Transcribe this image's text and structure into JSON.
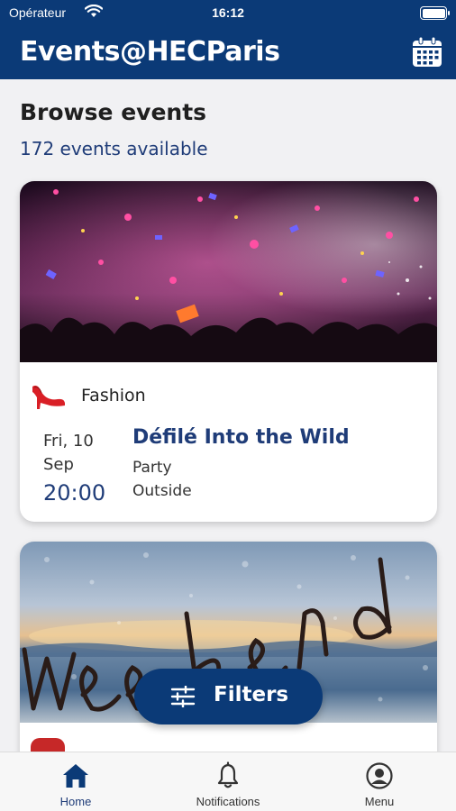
{
  "status_bar": {
    "carrier": "Opérateur",
    "time": "16:12"
  },
  "header": {
    "title": "Events@HECParis",
    "calendar_icon": "calendar-icon"
  },
  "browse": {
    "title": "Browse events",
    "count_text": "172 events available"
  },
  "events": [
    {
      "category": "Fashion",
      "category_icon": "high-heel-shoe-icon",
      "day": "Fri, 10",
      "month": "Sep",
      "time": "20:00",
      "title": "Défilé Into the Wild",
      "type": "Party",
      "place": "Outside"
    }
  ],
  "filters": {
    "label": "Filters",
    "icon": "sliders-icon"
  },
  "tabs": [
    {
      "label": "Home",
      "icon": "home-icon",
      "active": true
    },
    {
      "label": "Notifications",
      "icon": "bell-icon",
      "active": false
    },
    {
      "label": "Menu",
      "icon": "user-circle-icon",
      "active": false
    }
  ],
  "colors": {
    "primary": "#0b3a77",
    "accent_text": "#1f3c78",
    "background": "#f1f1f3"
  }
}
